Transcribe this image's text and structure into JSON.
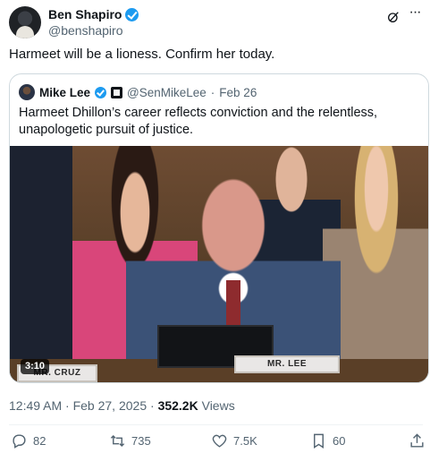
{
  "author": {
    "display_name": "Ben Shapiro",
    "handle": "@benshapiro",
    "verified": true
  },
  "tweet": {
    "text": "Harmeet will be a lioness. Confirm her today.",
    "timestamp": "12:49 AM · Feb 27, 2025",
    "separator": " · ",
    "views_count": "352.2K",
    "views_label": " Views"
  },
  "quoted_tweet": {
    "display_name": "Mike Lee",
    "handle": "@SenMikeLee",
    "separator": "·",
    "date": "Feb 26",
    "text": "Harmeet Dhillon’s career reflects conviction and the relentless, unapologetic pursuit of justice.",
    "video": {
      "duration": "3:10",
      "nameplate_main": "MR. LEE",
      "nameplate_side": "MR. CRUZ"
    }
  },
  "actions": {
    "replies": "82",
    "retweets": "735",
    "likes": "7.5K",
    "bookmarks": "60"
  },
  "icons": {
    "verified": "verified-badge-icon",
    "grok": "grok-icon",
    "more": "more-icon",
    "gov": "government-badge-icon",
    "reply": "reply-icon",
    "retweet": "retweet-icon",
    "like": "heart-icon",
    "bookmark": "bookmark-icon",
    "share": "share-icon"
  },
  "colors": {
    "verified_blue": "#1d9bf0",
    "text_primary": "#0f1419",
    "text_secondary": "#536471",
    "border": "#cfd9de"
  }
}
